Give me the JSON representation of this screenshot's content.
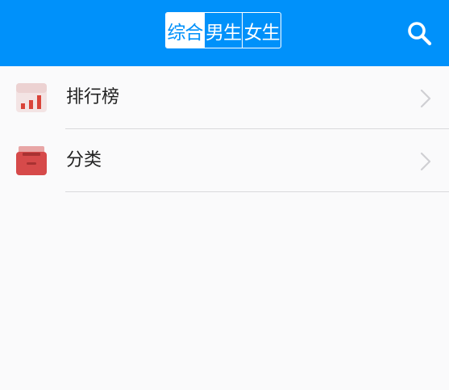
{
  "header": {
    "tabs": [
      {
        "label": "综合",
        "active": true
      },
      {
        "label": "男生",
        "active": false
      },
      {
        "label": "女生",
        "active": false
      }
    ],
    "search_icon": "search-icon",
    "accent_color": "#0091fa"
  },
  "menu": {
    "items": [
      {
        "label": "排行榜",
        "icon": "ranking-chart-icon"
      },
      {
        "label": "分类",
        "icon": "category-box-icon"
      }
    ],
    "chevron_icon": "chevron-right-icon"
  }
}
